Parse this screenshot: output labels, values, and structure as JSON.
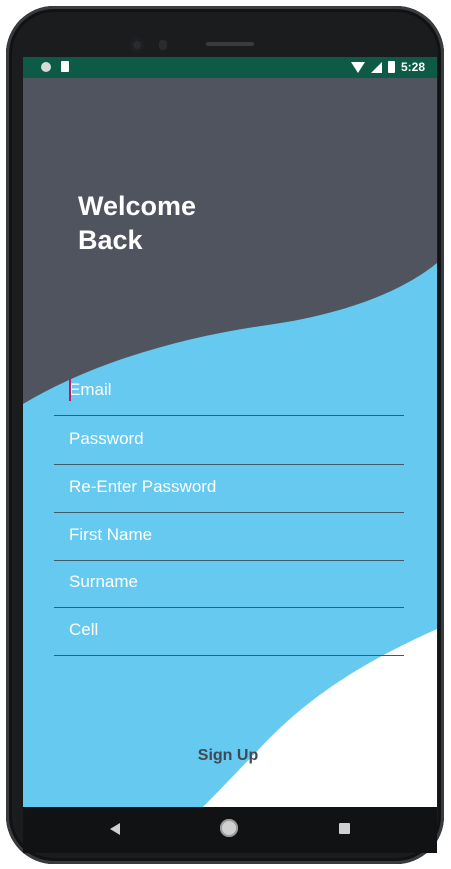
{
  "status_bar": {
    "time": "5:28",
    "icons": [
      "circle-notification-icon",
      "sd-card-icon",
      "wifi-icon",
      "signal-icon",
      "battery-icon"
    ]
  },
  "header": {
    "title_line1": "Welcome",
    "title_line2": "Back"
  },
  "form": {
    "fields": [
      {
        "placeholder": "Email",
        "value": "",
        "focused": true
      },
      {
        "placeholder": "Password",
        "value": ""
      },
      {
        "placeholder": "Re-Enter Password",
        "value": ""
      },
      {
        "placeholder": "First Name",
        "value": ""
      },
      {
        "placeholder": "Surname",
        "value": ""
      },
      {
        "placeholder": "Cell",
        "value": ""
      }
    ],
    "submit_label": "Sign Up"
  },
  "nav_bar": {
    "icons": [
      "back-triangle-icon",
      "home-circle-icon",
      "recents-square-icon"
    ]
  },
  "colors": {
    "status_bar": "#0d5b46",
    "header_dark": "#4f545f",
    "accent_blue": "#66c9f0",
    "bottom_white": "#ffffff",
    "caret": "#c2185b"
  }
}
